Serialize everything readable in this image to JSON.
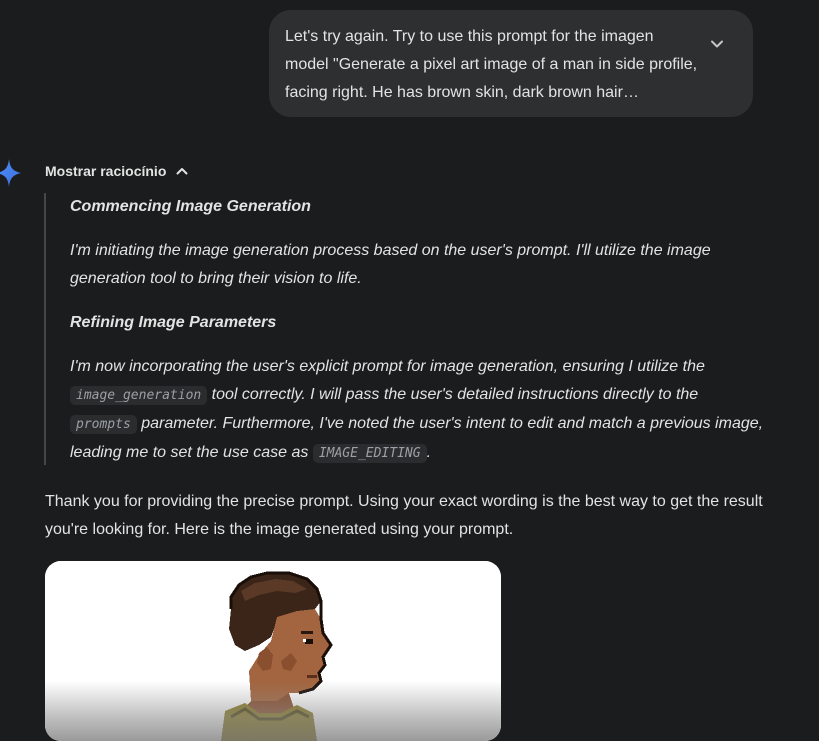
{
  "user_message": {
    "text": "Let's try again. Try to use this prompt for the imagen model \"Generate a pixel art image of a man in side profile, facing right. He has brown skin, dark brown hair…"
  },
  "reasoning": {
    "toggle_label": "Mostrar raciocínio",
    "heading_1": "Commencing Image Generation",
    "para_1": "I'm initiating the image generation process based on the user's prompt. I'll utilize the image generation tool to bring their vision to life.",
    "heading_2": "Refining Image Parameters",
    "para_2": {
      "t1": "I'm now incorporating the user's explicit prompt for image generation, ensuring I utilize the ",
      "code1": "image_generation",
      "t2": " tool correctly. I will pass the user's detailed instructions directly to the ",
      "code2": "prompts",
      "t3": " parameter. Furthermore, I've noted the user's intent to edit and match a previous image, leading me to set the use case as ",
      "code3": "IMAGE_EDITING",
      "t4": "."
    }
  },
  "answer": {
    "text": "Thank you for providing the precise prompt. Using your exact wording is the best way to get the result you're looking for. Here is the image generated using your prompt."
  },
  "colors": {
    "background": "#1b1c1d",
    "bubble": "#2d2f31",
    "text": "#e3e3e3",
    "spark": "#4f8ff7"
  }
}
